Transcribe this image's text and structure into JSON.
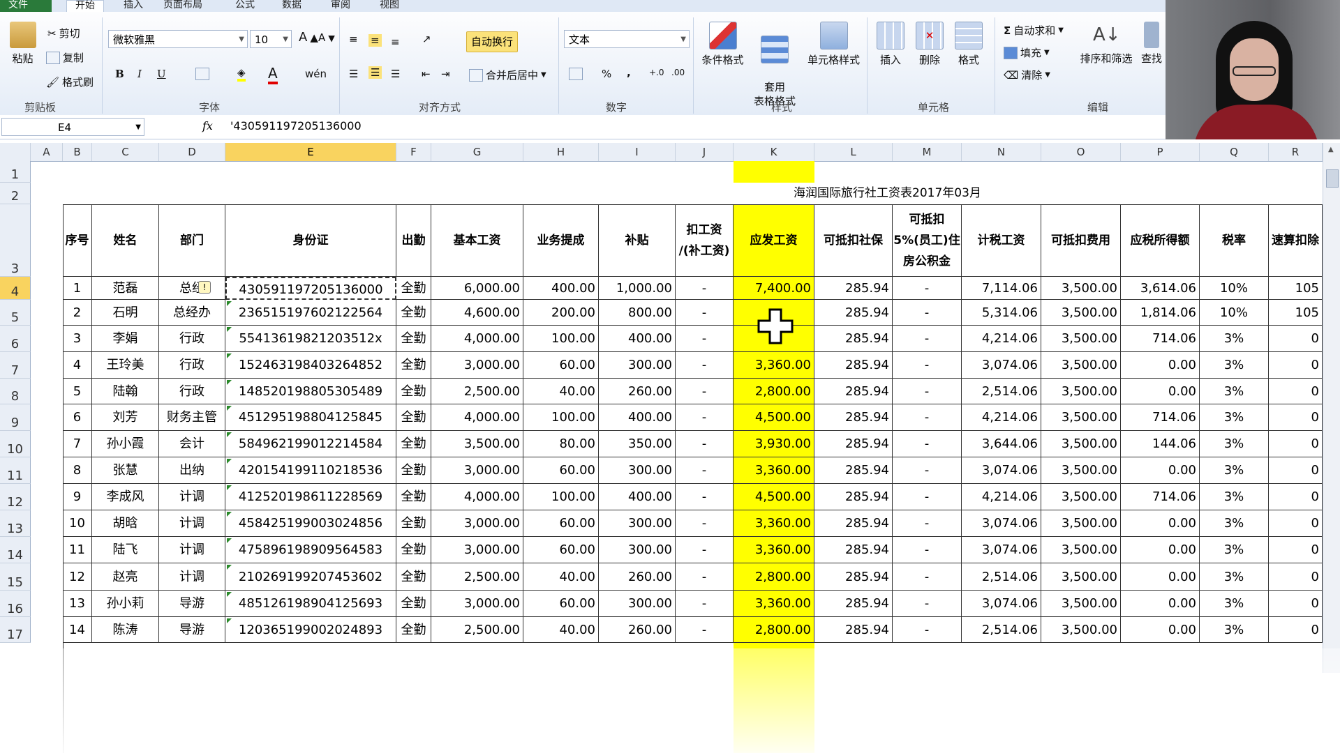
{
  "ribbon": {
    "tabs": [
      "文件",
      "开始",
      "插入",
      "页面布局",
      "公式",
      "数据",
      "审阅",
      "视图"
    ],
    "clipboard": {
      "paste": "粘贴",
      "cut": "剪切",
      "copy": "复制",
      "format_painter": "格式刷",
      "label": "剪贴板"
    },
    "font": {
      "name": "微软雅黑",
      "size": "10",
      "label": "字体",
      "bold": "B",
      "italic": "I",
      "underline": "U",
      "font_color": "A",
      "phonetic": "wén"
    },
    "alignment": {
      "wrap": "自动换行",
      "merge": "合并后居中",
      "label": "对齐方式"
    },
    "number": {
      "format": "文本",
      "percent": "%",
      "comma": ",",
      "label": "数字"
    },
    "styles": {
      "conditional": "条件格式",
      "table_style": "套用\n表格格式",
      "cell_style": "单元格样式",
      "label": "样式"
    },
    "cells": {
      "insert": "插入",
      "delete": "删除",
      "format": "格式",
      "label": "单元格"
    },
    "editing": {
      "autosum": "自动求和",
      "fill": "填充",
      "clear": "清除",
      "sort": "排序和筛选",
      "find": "查找",
      "label": "编辑"
    }
  },
  "formula_bar": {
    "name_box": "E4",
    "fx": "fx",
    "value": "'430591197205136000"
  },
  "columns": [
    "A",
    "B",
    "C",
    "D",
    "E",
    "F",
    "G",
    "H",
    "I",
    "J",
    "K",
    "L",
    "M",
    "N",
    "O",
    "P",
    "Q",
    "R"
  ],
  "rows": [
    "1",
    "2",
    "3",
    "4",
    "5",
    "6",
    "7",
    "8",
    "9",
    "10",
    "11",
    "12",
    "13",
    "14",
    "15",
    "16",
    "17"
  ],
  "sheet_title": "海润国际旅行社工资表2017年03月",
  "headers": [
    "序号",
    "姓名",
    "部门",
    "身份证",
    "出勤",
    "基本工资",
    "业务提成",
    "补贴",
    "扣工资\n/(补工资)",
    "应发工资",
    "可抵扣社保",
    "可抵扣\n5%(员工)住\n房公积金",
    "计税工资",
    "可抵扣费用",
    "应税所得额",
    "税率",
    "速算扣除"
  ],
  "data_rows": [
    [
      "1",
      "范磊",
      "总经",
      "430591197205136000",
      "全勤",
      "6,000.00",
      "400.00",
      "1,000.00",
      "-",
      "7,400.00",
      "285.94",
      "-",
      "7,114.06",
      "3,500.00",
      "3,614.06",
      "10%",
      "105"
    ],
    [
      "2",
      "石明",
      "总经办",
      "236515197602122564",
      "全勤",
      "4,600.00",
      "200.00",
      "800.00",
      "-",
      "",
      "285.94",
      "-",
      "5,314.06",
      "3,500.00",
      "1,814.06",
      "10%",
      "105"
    ],
    [
      "3",
      "李娟",
      "行政",
      "55413619821203512x",
      "全勤",
      "4,000.00",
      "100.00",
      "400.00",
      "-",
      "",
      "285.94",
      "-",
      "4,214.06",
      "3,500.00",
      "714.06",
      "3%",
      "0"
    ],
    [
      "4",
      "王玲美",
      "行政",
      "152463198403264852",
      "全勤",
      "3,000.00",
      "60.00",
      "300.00",
      "-",
      "3,360.00",
      "285.94",
      "-",
      "3,074.06",
      "3,500.00",
      "0.00",
      "3%",
      "0"
    ],
    [
      "5",
      "陆翰",
      "行政",
      "148520198805305489",
      "全勤",
      "2,500.00",
      "40.00",
      "260.00",
      "-",
      "2,800.00",
      "285.94",
      "-",
      "2,514.06",
      "3,500.00",
      "0.00",
      "3%",
      "0"
    ],
    [
      "6",
      "刘芳",
      "财务主管",
      "451295198804125845",
      "全勤",
      "4,000.00",
      "100.00",
      "400.00",
      "-",
      "4,500.00",
      "285.94",
      "-",
      "4,214.06",
      "3,500.00",
      "714.06",
      "3%",
      "0"
    ],
    [
      "7",
      "孙小霞",
      "会计",
      "584962199012214584",
      "全勤",
      "3,500.00",
      "80.00",
      "350.00",
      "-",
      "3,930.00",
      "285.94",
      "-",
      "3,644.06",
      "3,500.00",
      "144.06",
      "3%",
      "0"
    ],
    [
      "8",
      "张慧",
      "出纳",
      "420154199110218536",
      "全勤",
      "3,000.00",
      "60.00",
      "300.00",
      "-",
      "3,360.00",
      "285.94",
      "-",
      "3,074.06",
      "3,500.00",
      "0.00",
      "3%",
      "0"
    ],
    [
      "9",
      "李成风",
      "计调",
      "412520198611228569",
      "全勤",
      "4,000.00",
      "100.00",
      "400.00",
      "-",
      "4,500.00",
      "285.94",
      "-",
      "4,214.06",
      "3,500.00",
      "714.06",
      "3%",
      "0"
    ],
    [
      "10",
      "胡晗",
      "计调",
      "458425199003024856",
      "全勤",
      "3,000.00",
      "60.00",
      "300.00",
      "-",
      "3,360.00",
      "285.94",
      "-",
      "3,074.06",
      "3,500.00",
      "0.00",
      "3%",
      "0"
    ],
    [
      "11",
      "陆飞",
      "计调",
      "475896198909564583",
      "全勤",
      "3,000.00",
      "60.00",
      "300.00",
      "-",
      "3,360.00",
      "285.94",
      "-",
      "3,074.06",
      "3,500.00",
      "0.00",
      "3%",
      "0"
    ],
    [
      "12",
      "赵亮",
      "计调",
      "210269199207453602",
      "全勤",
      "2,500.00",
      "40.00",
      "260.00",
      "-",
      "2,800.00",
      "285.94",
      "-",
      "2,514.06",
      "3,500.00",
      "0.00",
      "3%",
      "0"
    ],
    [
      "13",
      "孙小莉",
      "导游",
      "485126198904125693",
      "全勤",
      "3,000.00",
      "60.00",
      "300.00",
      "-",
      "3,360.00",
      "285.94",
      "-",
      "3,074.06",
      "3,500.00",
      "0.00",
      "3%",
      "0"
    ],
    [
      "14",
      "陈涛",
      "导游",
      "120365199002024893",
      "全勤",
      "2,500.00",
      "40.00",
      "260.00",
      "-",
      "2,800.00",
      "285.94",
      "-",
      "2,514.06",
      "3,500.00",
      "0.00",
      "3%",
      "0"
    ]
  ],
  "colors": {
    "highlight": "#ffff00",
    "selected_header": "#f9d35f",
    "file_tab": "#2a7a3a"
  }
}
